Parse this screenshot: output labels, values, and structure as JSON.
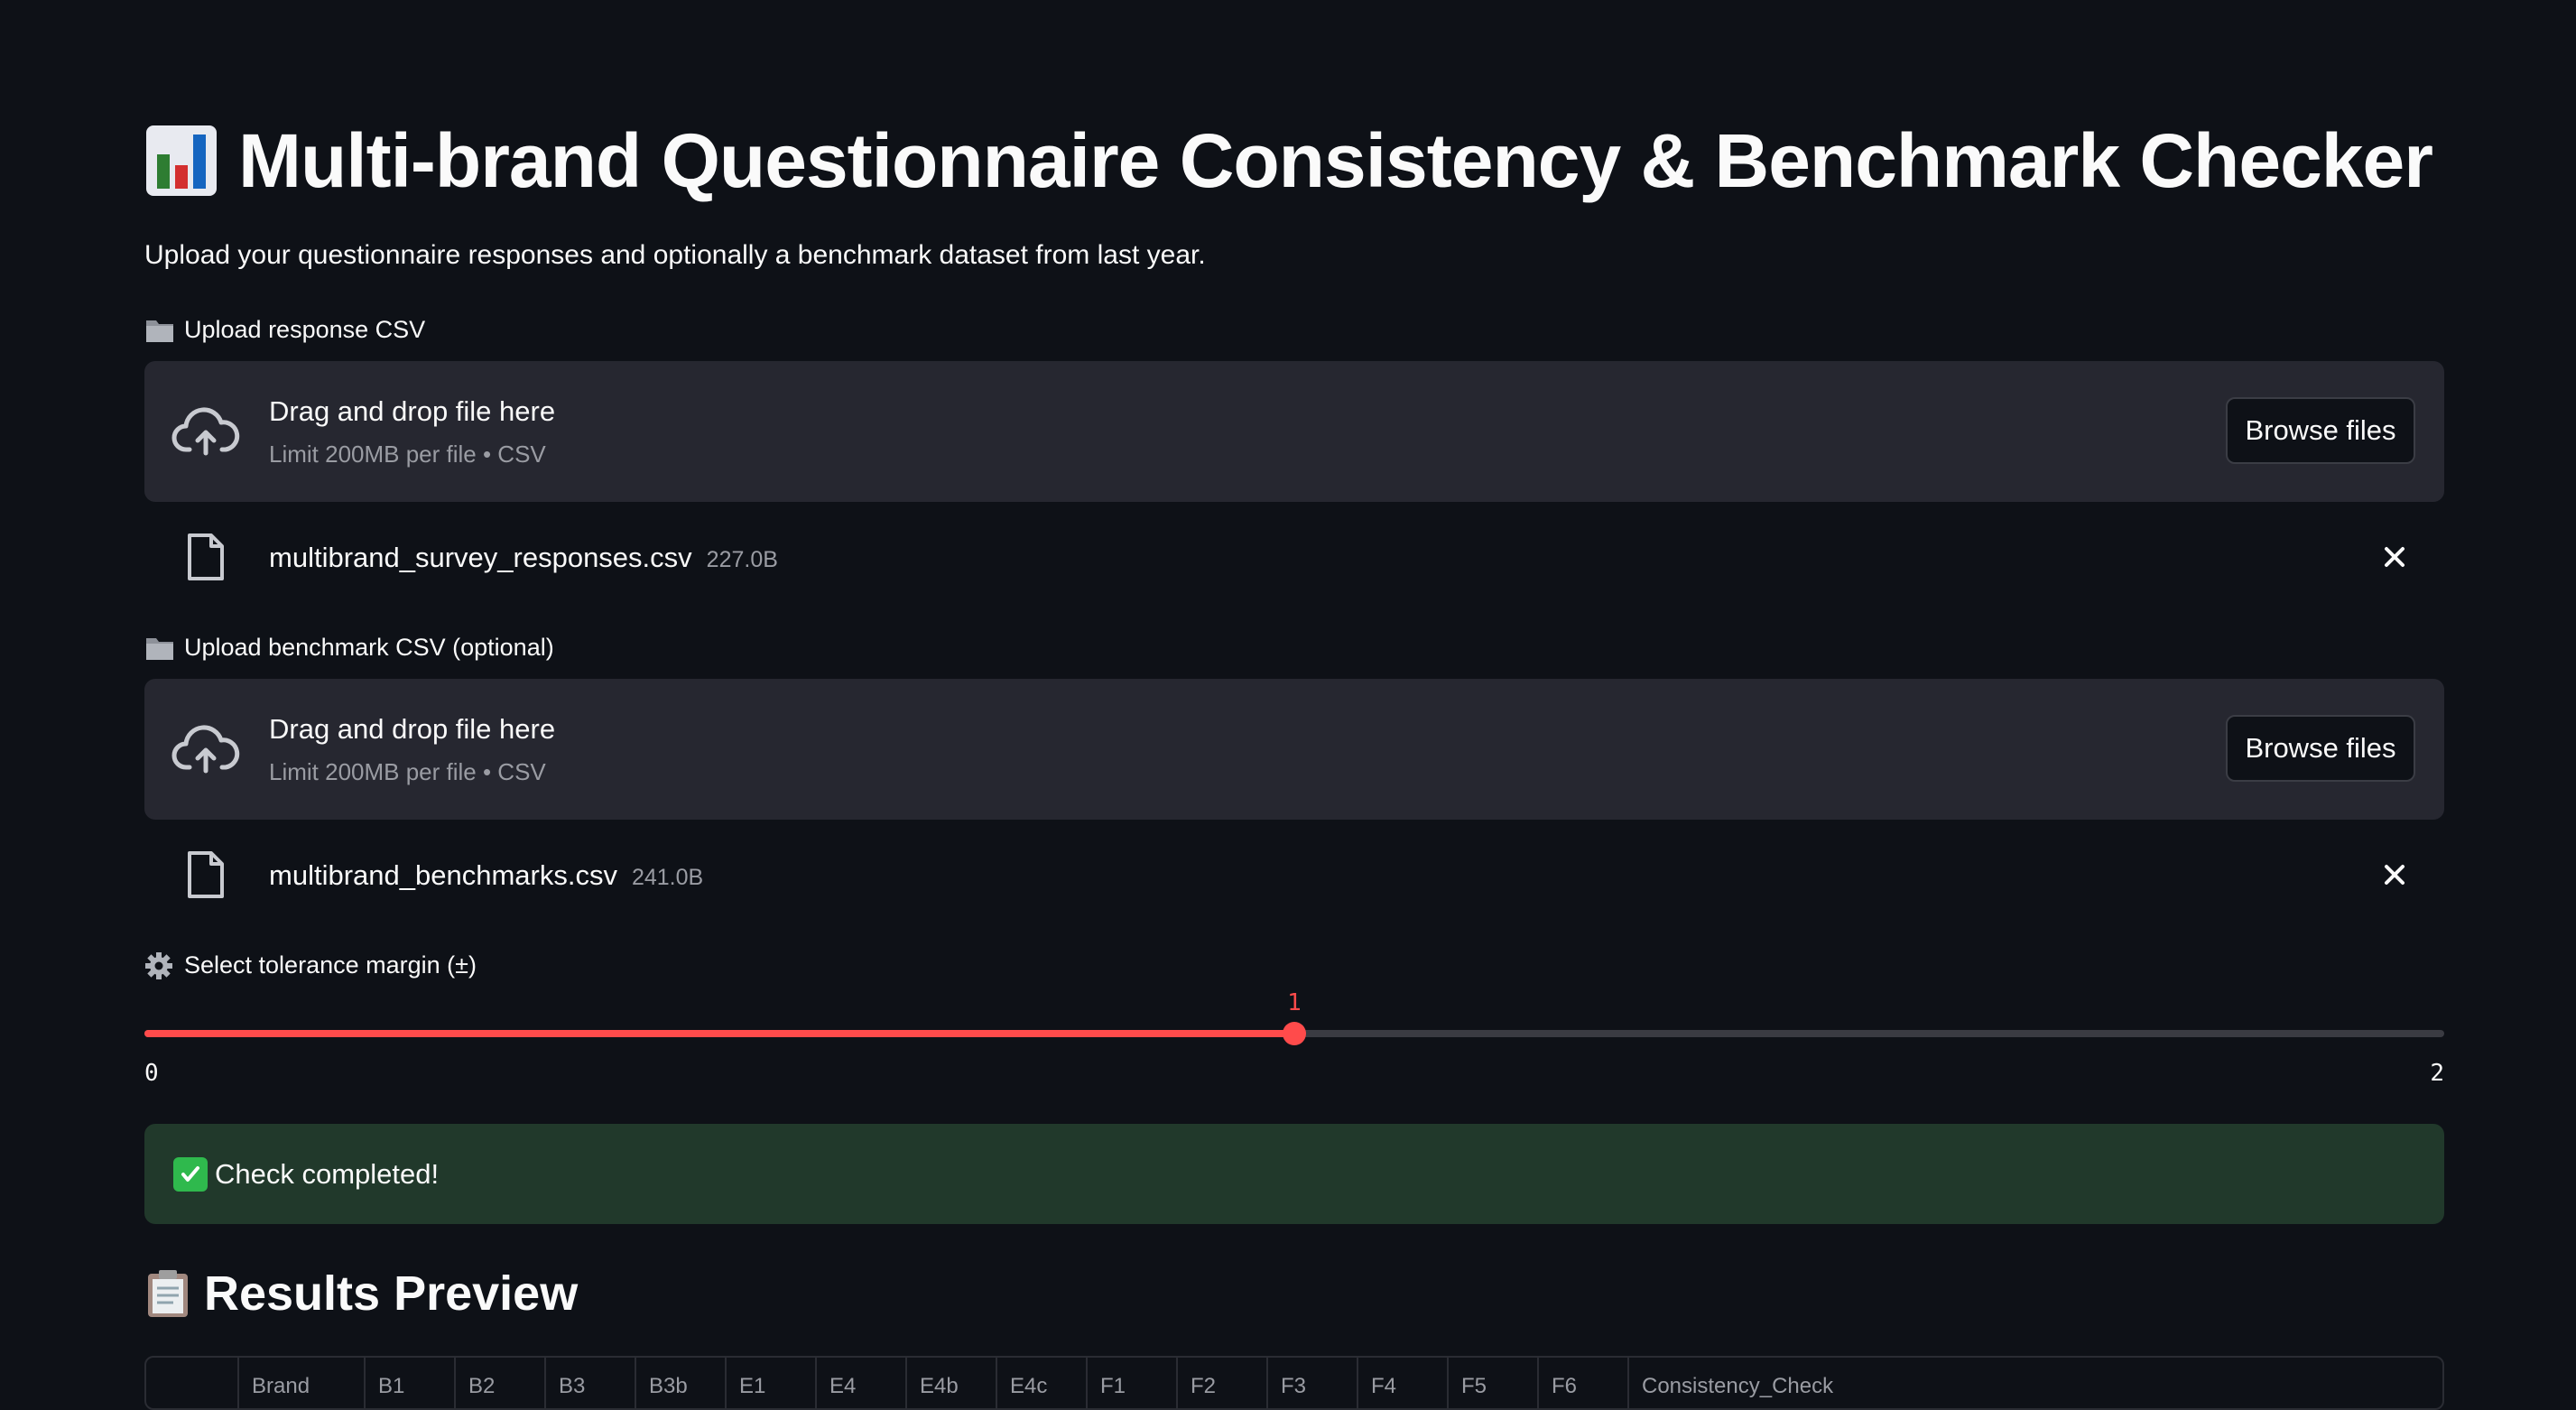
{
  "header": {
    "title": "Multi-brand Questionnaire Consistency & Benchmark Checker",
    "title_icon": "bar-chart-icon",
    "subtitle": "Upload your questionnaire responses and optionally a benchmark dataset from last year."
  },
  "response_upload": {
    "label": "Upload response CSV",
    "label_icon": "folder-icon",
    "dropzone_title": "Drag and drop file here",
    "dropzone_limit": "Limit 200MB per file • CSV",
    "browse_label": "Browse files",
    "file_name": "multibrand_survey_responses.csv",
    "file_size": "227.0B"
  },
  "benchmark_upload": {
    "label": "Upload benchmark CSV (optional)",
    "label_icon": "folder-icon",
    "dropzone_title": "Drag and drop file here",
    "dropzone_limit": "Limit 200MB per file • CSV",
    "browse_label": "Browse files",
    "file_name": "multibrand_benchmarks.csv",
    "file_size": "241.0B"
  },
  "tolerance": {
    "label": "Select tolerance margin (±)",
    "label_icon": "gear-icon",
    "value": "1",
    "min": "0",
    "max": "2",
    "fraction": 0.5,
    "accent": "#ff4b4b"
  },
  "status": {
    "message": "Check completed!",
    "icon": "check-mark-icon",
    "color": "#21392b"
  },
  "results": {
    "heading": "Results Preview",
    "heading_icon": "clipboard-icon",
    "columns": [
      "",
      "Brand",
      "B1",
      "B2",
      "B3",
      "B3b",
      "E1",
      "E4",
      "E4b",
      "E4c",
      "F1",
      "F2",
      "F3",
      "F4",
      "F5",
      "F6",
      "Consistency_Check"
    ]
  }
}
